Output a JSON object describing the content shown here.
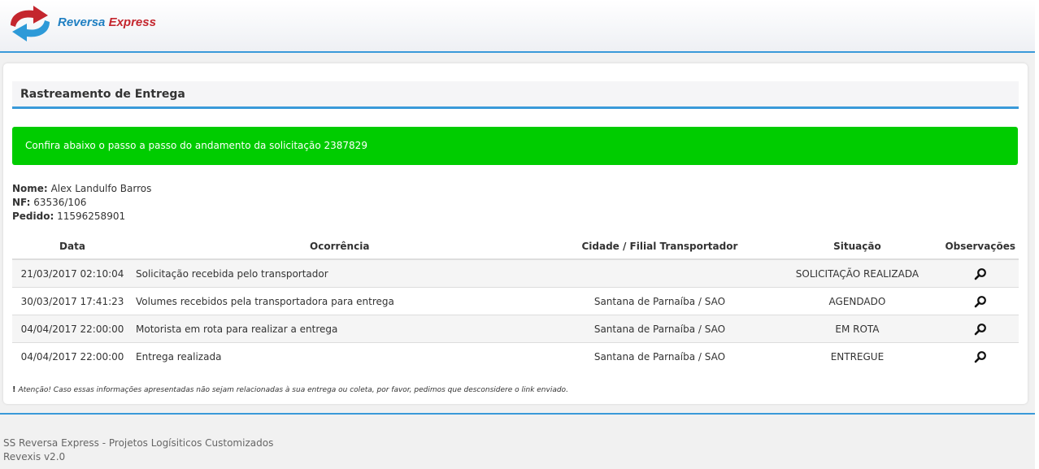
{
  "brand": {
    "name_part1": "Reversa",
    "name_part2": "Express",
    "colors": {
      "blue": "#1f7fc2",
      "red": "#c4262e",
      "accent": "#3a9ad9"
    }
  },
  "page": {
    "title": "Rastreamento de Entrega",
    "alert_text": "Confira abaixo o passo a passo do andamento da solicitação 2387829",
    "alert_color": "#00cc00"
  },
  "info": {
    "nome_label": "Nome:",
    "nome_value": "Alex Landulfo Barros",
    "nf_label": "NF:",
    "nf_value": "63536/106",
    "pedido_label": "Pedido:",
    "pedido_value": "11596258901"
  },
  "table": {
    "headers": {
      "data": "Data",
      "ocorrencia": "Ocorrência",
      "cidade": "Cidade / Filial Transportador",
      "situacao": "Situação",
      "observacoes": "Observações"
    },
    "rows": [
      {
        "data": "21/03/2017 02:10:04",
        "ocorrencia": "Solicitação recebida pelo transportador",
        "cidade": "",
        "situacao": "SOLICITAÇÃO REALIZADA",
        "obs_icon": "search-icon"
      },
      {
        "data": "30/03/2017 17:41:23",
        "ocorrencia": "Volumes recebidos pela transportadora para entrega",
        "cidade": "Santana de Parnaíba / SAO",
        "situacao": "AGENDADO",
        "obs_icon": "search-icon"
      },
      {
        "data": "04/04/2017 22:00:00",
        "ocorrencia": "Motorista em rota para realizar a entrega",
        "cidade": "Santana de Parnaíba / SAO",
        "situacao": "EM ROTA",
        "obs_icon": "search-icon"
      },
      {
        "data": "04/04/2017 22:00:00",
        "ocorrencia": "Entrega realizada",
        "cidade": "Santana de Parnaíba / SAO",
        "situacao": "ENTREGUE",
        "obs_icon": "search-icon"
      }
    ]
  },
  "note": {
    "mark": "!",
    "text": "Atenção! Caso essas informações apresentadas não sejam relacionadas à sua entrega ou coleta, por favor, pedimos que desconsidere o link enviado."
  },
  "footer": {
    "line1": "SS Reversa Express - Projetos Logísiticos Customizados",
    "line2": "Revexis v2.0"
  }
}
